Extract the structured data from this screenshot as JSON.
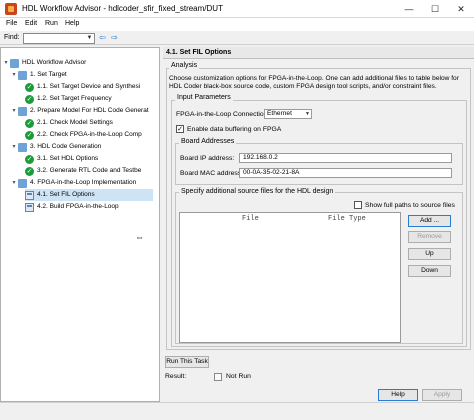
{
  "window": {
    "title": "HDL Workflow Advisor - hdlcoder_sfir_fixed_stream/DUT",
    "minimize": "—",
    "maximize": "☐",
    "close": "✕"
  },
  "menu": [
    "File",
    "Edit",
    "Run",
    "Help"
  ],
  "find": {
    "label": "Find:",
    "value": "",
    "prev_icon": "arrow-left-icon",
    "next_icon": "arrow-right-icon"
  },
  "tree": {
    "items": [
      {
        "label": "HDL Workflow Advisor",
        "icon": "folder",
        "level": 0,
        "twisty": "▾"
      },
      {
        "label": "1. Set Target",
        "icon": "folder",
        "level": 1,
        "twisty": "▾"
      },
      {
        "label": "1.1. Set Target Device and Synthesi",
        "icon": "check",
        "level": 2,
        "twisty": ""
      },
      {
        "label": "1.2. Set Target Frequency",
        "icon": "check",
        "level": 2,
        "twisty": ""
      },
      {
        "label": "2. Prepare Model For HDL Code Generat",
        "icon": "folder",
        "level": 1,
        "twisty": "▾"
      },
      {
        "label": "2.1. Check Model Settings",
        "icon": "check",
        "level": 2,
        "twisty": ""
      },
      {
        "label": "2.2. Check FPGA-in-the-Loop Comp",
        "icon": "check",
        "level": 2,
        "twisty": ""
      },
      {
        "label": "3. HDL Code Generation",
        "icon": "folder",
        "level": 1,
        "twisty": "▾"
      },
      {
        "label": "3.1. Set HDL Options",
        "icon": "check",
        "level": 2,
        "twisty": ""
      },
      {
        "label": "3.2. Generate RTL Code and Testbe",
        "icon": "check",
        "level": 2,
        "twisty": ""
      },
      {
        "label": "4. FPGA-in-the-Loop Implementation",
        "icon": "folder",
        "level": 1,
        "twisty": "▾"
      },
      {
        "label": "4.1. Set FIL Options",
        "icon": "task",
        "level": 2,
        "twisty": "",
        "selected": true
      },
      {
        "label": "4.2. Build FPGA-in-the-Loop",
        "icon": "task",
        "level": 2,
        "twisty": ""
      }
    ]
  },
  "panel": {
    "header": "4.1. Set FIL Options",
    "analysis_label": "Analysis",
    "description": "Choose customization options for FPGA-in-the-Loop. One can add additional files to table below for HDL Coder black-box source code, custom FPGA design tool scripts, and/or constraint files.",
    "input_parameters_label": "Input Parameters",
    "connection_label": "FPGA-in-the-Loop Connection:",
    "connection_value": "Ethernet",
    "buffering_label": "Enable data buffering on FPGA",
    "buffering_checked": "✓",
    "board_addresses_label": "Board Addresses",
    "ip_label": "Board IP address:",
    "ip_value": "192.168.0.2",
    "mac_label": "Board MAC address:",
    "mac_value": "00-0A-35-02-21-8A",
    "sources_label": "Specify additional source files for the HDL design",
    "show_full_paths_label": "Show full paths to source files",
    "table_headers": [
      "File",
      "File Type"
    ],
    "buttons": {
      "add": "Add ...",
      "remove": "Remove",
      "up": "Up",
      "down": "Down"
    },
    "run_task": "Run This Task",
    "result_label": "Result:",
    "result_value": "Not Run",
    "help": "Help",
    "apply": "Apply"
  }
}
